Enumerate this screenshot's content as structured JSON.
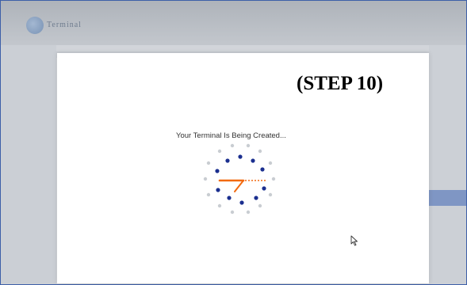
{
  "app": {
    "brand_name": "Terminal",
    "logo_icon": "globe-logo-icon"
  },
  "dialog": {
    "step_label": "(STEP 10)",
    "status_text": "Your Terminal Is Being Created..."
  },
  "spinner": {
    "icon": "loading-spinner-icon",
    "dot_color": "#1b2f8f",
    "faded_dot_color": "#c9cdd2",
    "hand_color": "#f26a10"
  },
  "colors": {
    "frame_border": "#3d5fa8",
    "highlight_band": "#7f96c4"
  }
}
